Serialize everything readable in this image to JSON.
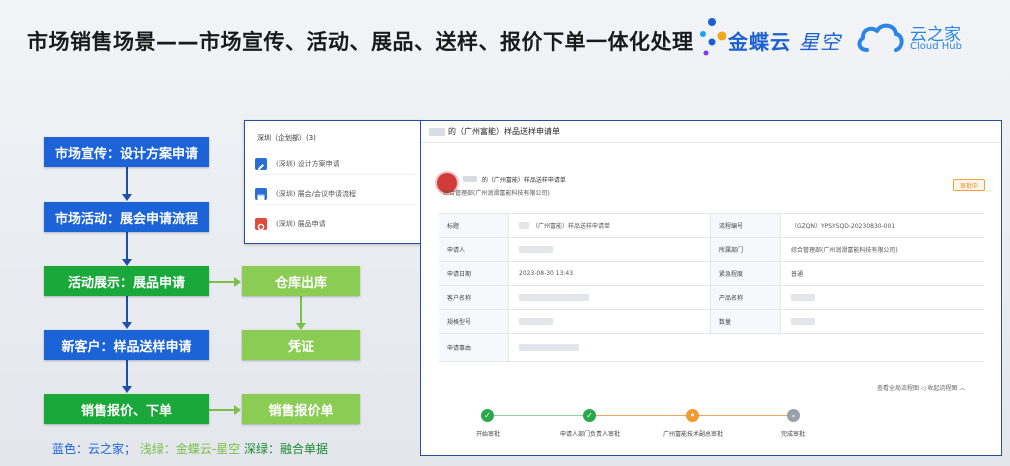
{
  "title": "市场销售场景——市场宣传、活动、展品、送样、报价下单一体化处理",
  "logos": {
    "kingdee_bold": "金蝶云",
    "kingdee_light": "星空",
    "cloudhub_cn": "云之家",
    "cloudhub_en": "Cloud Hub"
  },
  "flow": {
    "main": [
      {
        "label": "市场宣传：设计方案申请",
        "color": "blue"
      },
      {
        "label": "市场活动：展会申请流程",
        "color": "blue"
      },
      {
        "label": "活动展示：展品申请",
        "color": "dgreen"
      },
      {
        "label": "新客户：样品送样申请",
        "color": "blue"
      },
      {
        "label": "销售报价、下单",
        "color": "dgreen"
      }
    ],
    "side": [
      {
        "label": "仓库出库",
        "color": "lgreen"
      },
      {
        "label": "凭证",
        "color": "lgreen"
      },
      {
        "label": "销售报价单",
        "color": "lgreen"
      }
    ]
  },
  "legend": {
    "blue": "蓝色：云之家；",
    "light": "浅绿：金蝶云-星空",
    "dark": "深绿：融合单据"
  },
  "colors": {
    "blue": "#1b63d6",
    "dark_green": "#1aa83a",
    "light_green": "#8bcc55",
    "status_orange": "#e08a20"
  },
  "popup": {
    "title": "深圳（企划部）(3)",
    "items": [
      {
        "label": "(深圳) 设计方案申请",
        "icon": "edit-icon"
      },
      {
        "label": "(深圳) 展会/会议申请流程",
        "icon": "calendar-icon"
      },
      {
        "label": "(深圳) 展品申请",
        "icon": "box-icon"
      }
    ]
  },
  "form": {
    "title": "的（广州富能）样品送样申请单",
    "applicant_title": "的（广州富能）样品送样申请单",
    "department": "综合管理部(广州润滑富能科技有限公司)",
    "status": "审批中",
    "fields": {
      "r1_l1": "标题",
      "r1_v1": "（广州富能）样品送样申请单",
      "r1_l2": "流程编号",
      "r1_v2": "（GZQN）YPSYSQD-20230830-001",
      "r2_l1": "申请人",
      "r2_v1": "",
      "r2_l2": "所属部门",
      "r2_v2": "综合管理部(广州润滑富能科技有限公司)",
      "r3_l1": "申请日期",
      "r3_v1": "2023-08-30 13:43",
      "r3_l2": "紧急程度",
      "r3_v2": "普通",
      "r4_l1": "客户名称",
      "r4_v1": "",
      "r4_l2": "产品名称",
      "r4_v2": "",
      "r5_l1": "规格型号",
      "r5_v1": "",
      "r5_l2": "数量",
      "r5_v2": "",
      "r6_l1": "申请事由",
      "r6_v1": ""
    },
    "links": "查看全局流程图 ◁   收起流程图 ︿",
    "steps": [
      {
        "label": "开始审批",
        "state": "done"
      },
      {
        "label": "申请人部门负责人审批",
        "state": "done"
      },
      {
        "label": "广州富能技术副总审批",
        "state": "current"
      },
      {
        "label": "完成审批",
        "state": "pending"
      }
    ],
    "step_icons": {
      "done": "✓",
      "current": "•",
      "pending": "–"
    }
  }
}
